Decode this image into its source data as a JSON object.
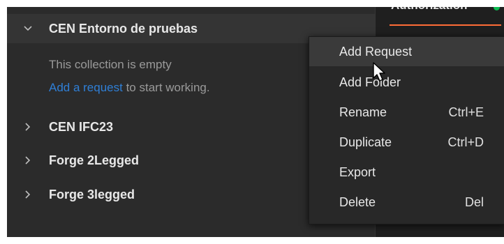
{
  "right_pane": {
    "tab_label": "Authorization"
  },
  "sidebar": {
    "collections": [
      {
        "name": "CEN Entorno de pruebas",
        "expanded": true
      },
      {
        "name": "CEN IFC23",
        "expanded": false
      },
      {
        "name": "Forge 2Legged",
        "expanded": false
      },
      {
        "name": "Forge 3legged",
        "expanded": false
      }
    ],
    "empty_state": {
      "message": "This collection is empty",
      "link": "Add a request",
      "suffix": " to start working."
    }
  },
  "context_menu": {
    "items": [
      {
        "label": "Add Request",
        "shortcut": ""
      },
      {
        "label": "Add Folder",
        "shortcut": ""
      },
      {
        "label": "Rename",
        "shortcut": "Ctrl+E"
      },
      {
        "label": "Duplicate",
        "shortcut": "Ctrl+D"
      },
      {
        "label": "Export",
        "shortcut": ""
      },
      {
        "label": "Delete",
        "shortcut": "Del"
      }
    ]
  },
  "colors": {
    "link": "#2f7fd6",
    "active_tab_underline": "#ff6c37",
    "status_dot": "#0cbb52"
  }
}
